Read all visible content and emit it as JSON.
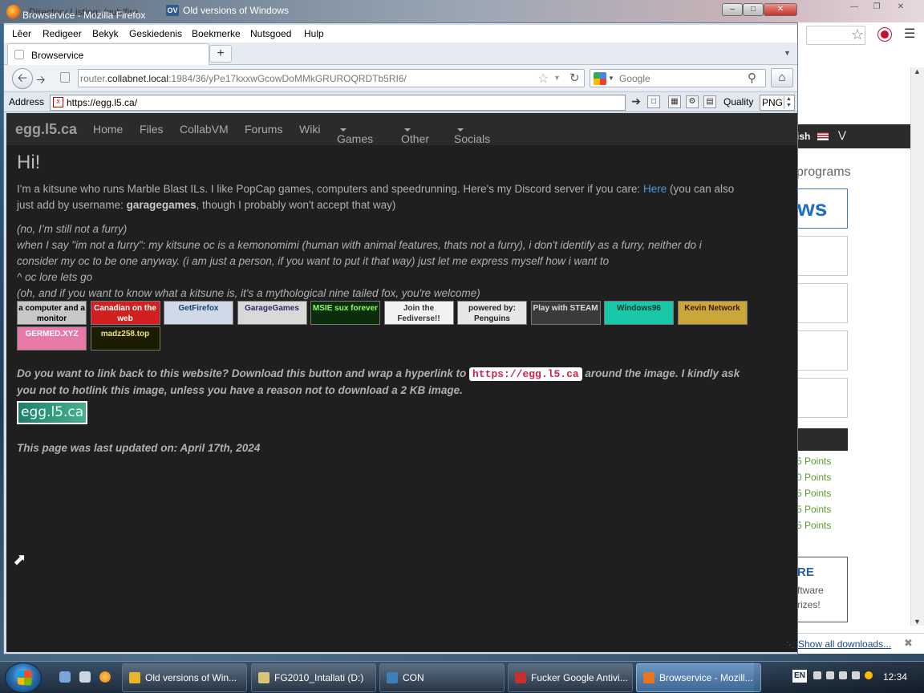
{
  "background_windows": {
    "tab1_title": "Directory Listing: /pub/fire",
    "tab2_title": "Old versions of Windows",
    "tab2_icon": "OV",
    "chrome_right": {
      "nav_text": "ish",
      "heading": "programs",
      "logo_text": "ws",
      "points": [
        "5 Points",
        "0 Points",
        "5 Points",
        "5 Points",
        "5 Points"
      ],
      "promo_title": "RE",
      "promo_line1": "ftware",
      "promo_line2": "rizes!",
      "show_downloads": "Show all downloads..."
    }
  },
  "window": {
    "title": "Browservice - Mozilla Firefox",
    "controls": {
      "minimize": "‒",
      "maximize": "□",
      "close": "✕"
    }
  },
  "menu": [
    "Lêer",
    "Redigeer",
    "Bekyk",
    "Geskiedenis",
    "Boekmerke",
    "Nutsgoed",
    "Hulp"
  ],
  "tab": {
    "title": "Browservice",
    "new_tab": "+"
  },
  "url": {
    "prefix": "router.",
    "host": "collabnet.local",
    "rest": ":1984/36/yPe17kxxwGcowDoMMkGRUROQRDTb5RI6/"
  },
  "search": {
    "engine": "Google",
    "placeholder": "Google"
  },
  "browservice_bar": {
    "address_label": "Address",
    "address_value": "https://egg.l5.ca/",
    "quality_label": "Quality",
    "quality_value": "PNG"
  },
  "site": {
    "brand": "egg.l5.ca",
    "nav": [
      {
        "label": "Home",
        "caret": false
      },
      {
        "label": "Files",
        "caret": false
      },
      {
        "label": "CollabVM",
        "caret": false
      },
      {
        "label": "Forums",
        "caret": false
      },
      {
        "label": "Wiki",
        "caret": false
      },
      {
        "label": "Games",
        "caret": true
      },
      {
        "label": "Other",
        "caret": true
      },
      {
        "label": "Socials",
        "caret": true
      }
    ],
    "heading": "Hi!",
    "intro_1": "I'm a kitsune who runs Marble Blast ILs. I like PopCap games, computers and speedrunning. Here's my Discord server if you care: ",
    "intro_link": "Here",
    "intro_2": " (you can also",
    "intro_3": "just add by username: ",
    "intro_username": "garagegames",
    "intro_4": ", though I probably won't accept that way)",
    "italic_lines": [
      "(no, I’m still not a furry)",
      "when I say \"im not a furry\": my kitsune oc is a kemonomimi (human with animal features, thats not a furry), i don't identify as a furry, neither do i",
      "consider my oc to be one anyway. (i am just a person, if you want to put it that way) just let me express myself how i want to",
      "^ oc lore lets go",
      "(oh, and if you want to know what a kitsune is, it's a mythological nine tailed fox, you're welcome)"
    ],
    "badges": [
      {
        "text": "a computer and a monitor",
        "bg": "#c8c8c8",
        "fg": "#000"
      },
      {
        "text": "Canadian on the web",
        "bg": "#d21f1f",
        "fg": "#fff"
      },
      {
        "text": "GetFirefox",
        "bg": "#cfd9e8",
        "fg": "#1b3f7a"
      },
      {
        "text": "GarageGames",
        "bg": "#d9d9d9",
        "fg": "#2b2b6b"
      },
      {
        "text": "MSIE sux forever",
        "bg": "#0b2d0b",
        "fg": "#8cff5a"
      },
      {
        "text": "Join the Fediverse!!",
        "bg": "#f2f2f2",
        "fg": "#333"
      },
      {
        "text": "powered by: Penguins",
        "bg": "#e6e6e6",
        "fg": "#222"
      },
      {
        "text": "Play with STEAM",
        "bg": "#3a3a3a",
        "fg": "#ddd"
      },
      {
        "text": "Windows96",
        "bg": "#18c8a8",
        "fg": "#0a3a2a"
      },
      {
        "text": "Kevin Network",
        "bg": "#c9a73a",
        "fg": "#3a1a00"
      },
      {
        "text": "GERMED.XYZ",
        "bg": "#e87aa8",
        "fg": "#fff"
      },
      {
        "text": "madz258.top",
        "bg": "#1c1c00",
        "fg": "#f0e07a"
      }
    ],
    "linkback_1": "Do you want to link back to this website? Download this button and wrap a hyperlink to ",
    "linkback_code": "https://egg.l5.ca",
    "linkback_2": " around the image. I kindly ask",
    "linkback_3": "you not to hotlink this image, unless you have a reason not to download a 2 KB image.",
    "site_button": "egg.l5.ca",
    "updated": "This page was last updated on: April 17th, 2024"
  },
  "taskbar": {
    "items": [
      {
        "label": "Old versions of Win...",
        "color": "#e8b52b",
        "active": false
      },
      {
        "label": "FG2010_Intallati (D:)",
        "color": "#d9c27a",
        "active": false
      },
      {
        "label": "CON",
        "color": "#3d7fb8",
        "active": false
      },
      {
        "label": "Fucker Google Antivi...",
        "color": "#c4302b",
        "active": false
      },
      {
        "label": "Browservice - Mozill...",
        "color": "#e8741c",
        "active": true
      }
    ],
    "language": "EN",
    "clock": "12:34"
  },
  "colors": {
    "link": "#4d9bd9",
    "page_bg": "#1f1f1f"
  }
}
